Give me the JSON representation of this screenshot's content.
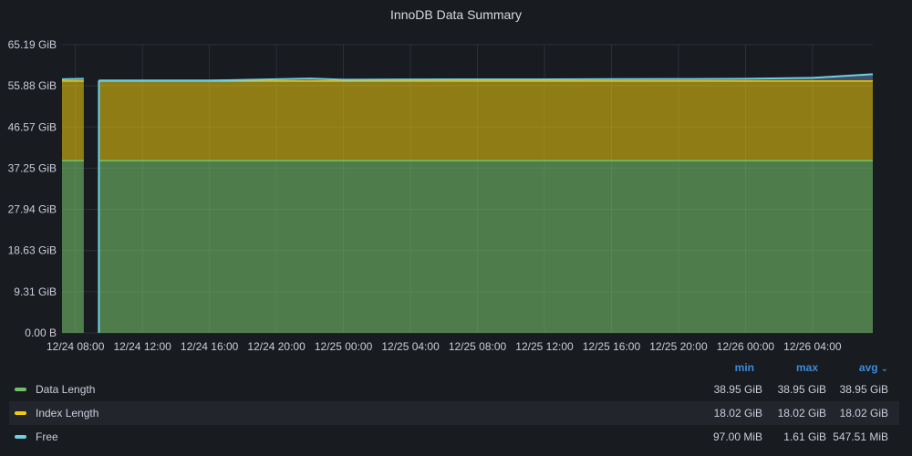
{
  "panel": {
    "title": "InnoDB Data Summary"
  },
  "colors": {
    "data_length": "#73bf69",
    "index_length": "#f2cc0c",
    "free": "#8ab8ff",
    "free_line": "#6ed0e0",
    "grid": "#2c3038",
    "header": "#3d8bd9"
  },
  "chart_data": {
    "type": "area",
    "stacked": true,
    "title": "InnoDB Data Summary",
    "y_unit": "GiB",
    "ylim": [
      0,
      65.19
    ],
    "y_ticks": [
      "0.00 B",
      "9.31 GiB",
      "18.63 GiB",
      "27.94 GiB",
      "37.25 GiB",
      "46.57 GiB",
      "55.88 GiB",
      "65.19 GiB"
    ],
    "y_tick_values": [
      0,
      9.31,
      18.63,
      27.94,
      37.25,
      46.57,
      55.88,
      65.19
    ],
    "x_ticks": [
      "12/24 08:00",
      "12/24 12:00",
      "12/24 16:00",
      "12/24 20:00",
      "12/25 00:00",
      "12/25 04:00",
      "12/25 08:00",
      "12/25 12:00",
      "12/25 16:00",
      "12/25 20:00",
      "12/26 00:00",
      "12/26 04:00"
    ],
    "x_tick_hours": [
      8,
      12,
      16,
      20,
      24,
      28,
      32,
      36,
      40,
      44,
      48,
      52
    ],
    "x_range_hours": [
      7.2,
      55.6
    ],
    "gaps_hours": [
      [
        8.5,
        9.4
      ]
    ],
    "series": [
      {
        "name": "Data Length",
        "x_hours": [
          7.2,
          55.6
        ],
        "values": [
          38.95,
          38.95
        ]
      },
      {
        "name": "Index Length",
        "x_hours": [
          7.2,
          55.6
        ],
        "values": [
          18.02,
          18.02
        ]
      },
      {
        "name": "Free",
        "x_hours": [
          7.2,
          8.5,
          9.4,
          16.0,
          18.0,
          20.0,
          22.0,
          24.0,
          28.0,
          32.0,
          36.0,
          40.0,
          44.0,
          48.0,
          52.0,
          55.6
        ],
        "values": [
          0.4,
          0.5,
          0.12,
          0.12,
          0.25,
          0.4,
          0.55,
          0.3,
          0.35,
          0.38,
          0.38,
          0.42,
          0.45,
          0.52,
          0.72,
          1.55
        ]
      }
    ],
    "legend": {
      "placement": "bottom",
      "columns": [
        "min",
        "max",
        "avg"
      ],
      "sorted_by": "avg",
      "rows": [
        {
          "name": "Data Length",
          "min": "38.95 GiB",
          "max": "38.95 GiB",
          "avg": "38.95 GiB"
        },
        {
          "name": "Index Length",
          "min": "18.02 GiB",
          "max": "18.02 GiB",
          "avg": "18.02 GiB"
        },
        {
          "name": "Free",
          "min": "97.00 MiB",
          "max": "1.61 GiB",
          "avg": "547.51 MiB"
        }
      ]
    }
  }
}
